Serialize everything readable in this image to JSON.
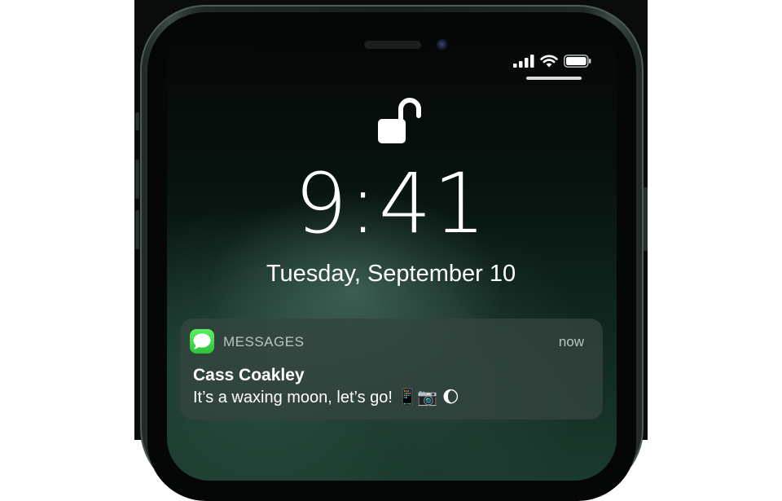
{
  "status_bar": {
    "signal_icon": "cellular-signal-icon",
    "wifi_icon": "wifi-icon",
    "battery_icon": "battery-icon"
  },
  "lock_screen": {
    "lock_icon": "unlocked-padlock-icon",
    "time": "9:41",
    "date": "Tuesday, September 10"
  },
  "notification": {
    "app_icon": "messages-app-icon",
    "app_name": "MESSAGES",
    "timestamp": "now",
    "sender": "Cass Coakley",
    "message": "It’s a waxing moon, let’s go! 📱📷 🌔"
  },
  "colors": {
    "notification_bg": "#34443f",
    "messages_green": "#34c759"
  }
}
